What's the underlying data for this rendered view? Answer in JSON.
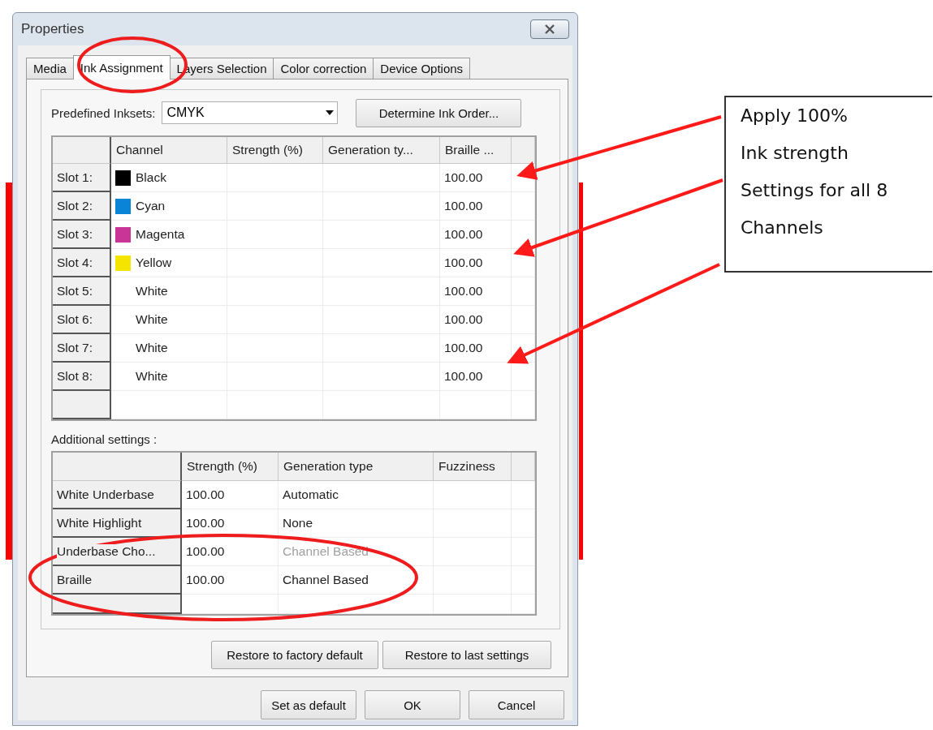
{
  "window": {
    "title": "Properties"
  },
  "tabs": [
    {
      "label": "Media",
      "selected": false
    },
    {
      "label": "Ink Assignment",
      "selected": true
    },
    {
      "label": "Layers Selection",
      "selected": false
    },
    {
      "label": "Color correction",
      "selected": false
    },
    {
      "label": "Device Options",
      "selected": false
    }
  ],
  "inkset": {
    "label": "Predefined Inksets:",
    "value": "CMYK",
    "button": "Determine Ink Order..."
  },
  "ink_table": {
    "columns": [
      "Channel",
      "Strength (%)",
      "Generation ty...",
      "Braille ..."
    ],
    "rows": [
      {
        "slot": "Slot 1:",
        "channel": "Black",
        "color": "#000000",
        "braille": "100.00"
      },
      {
        "slot": "Slot 2:",
        "channel": "Cyan",
        "color": "#0a84d6",
        "braille": "100.00"
      },
      {
        "slot": "Slot 3:",
        "channel": "Magenta",
        "color": "#c93596",
        "braille": "100.00"
      },
      {
        "slot": "Slot 4:",
        "channel": "Yellow",
        "color": "#f5e400",
        "braille": "100.00"
      },
      {
        "slot": "Slot 5:",
        "channel": "White",
        "braille": "100.00"
      },
      {
        "slot": "Slot 6:",
        "channel": "White",
        "braille": "100.00"
      },
      {
        "slot": "Slot 7:",
        "channel": "White",
        "braille": "100.00"
      },
      {
        "slot": "Slot 8:",
        "channel": "White",
        "braille": "100.00"
      }
    ]
  },
  "additional_settings": {
    "label": "Additional settings :",
    "columns": [
      "Strength (%)",
      "Generation type",
      "Fuzziness"
    ],
    "rows": [
      {
        "name": "White Underbase",
        "strength": "100.00",
        "generation": "Automatic",
        "disabled": false
      },
      {
        "name": "White Highlight",
        "strength": "100.00",
        "generation": "None",
        "disabled": false
      },
      {
        "name": "Underbase Cho...",
        "strength": "100.00",
        "generation": "Channel Based",
        "disabled": true
      },
      {
        "name": "Braille",
        "strength": "100.00",
        "generation": "Channel Based",
        "disabled": false
      }
    ]
  },
  "restore_buttons": [
    "Restore to factory default",
    "Restore to last settings"
  ],
  "footer_buttons": [
    "Set as default",
    "OK",
    "Cancel"
  ],
  "callout": {
    "lines": [
      "Apply 100%",
      "Ink strength",
      "Settings for all 8",
      "Channels"
    ]
  }
}
